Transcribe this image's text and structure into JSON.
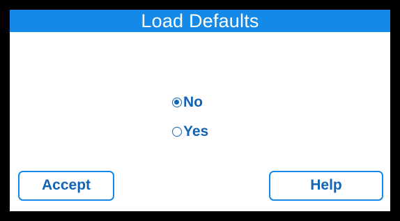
{
  "window": {
    "title": "Load Defaults"
  },
  "options": [
    {
      "label": "No",
      "selected": true
    },
    {
      "label": "Yes",
      "selected": false
    }
  ],
  "buttons": {
    "accept_label": "Accept",
    "help_label": "Help"
  },
  "colors": {
    "title_bar": "#1589e8",
    "accent_text": "#1264b8",
    "frame": "#000000",
    "background": "#ffffff"
  }
}
